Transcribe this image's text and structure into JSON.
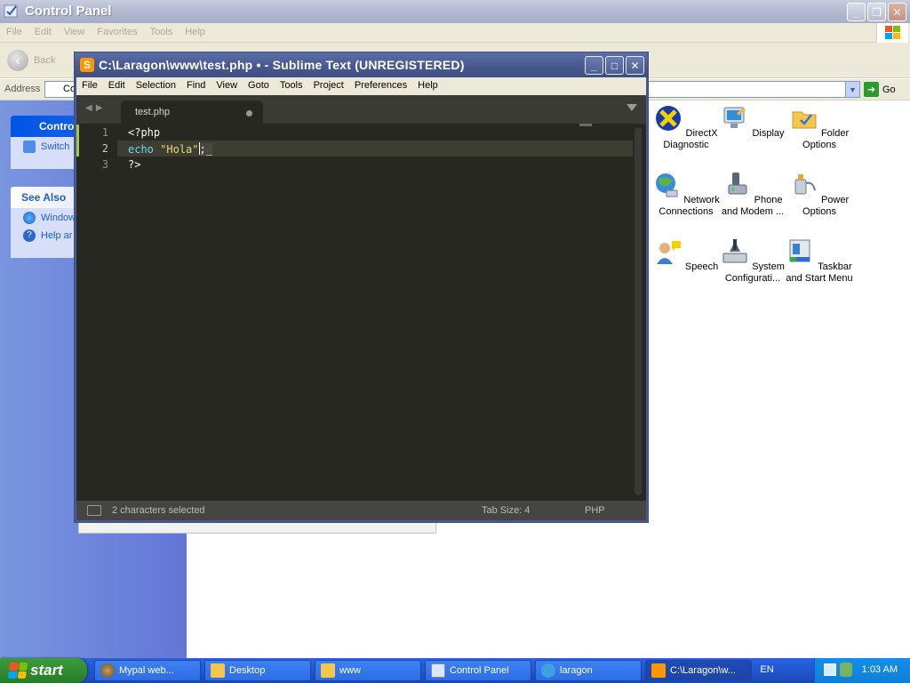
{
  "control_panel": {
    "title": "Control Panel",
    "menu": [
      "File",
      "Edit",
      "View",
      "Favorites",
      "Tools",
      "Help"
    ],
    "back_label": "Back",
    "address_label": "Address",
    "address_value": "Co",
    "go_label": "Go",
    "left_panel": {
      "header": "Contro",
      "switch_label": "Switch",
      "see_also": "See Also",
      "items": [
        "Window",
        "Help ar"
      ]
    },
    "icons": [
      {
        "label": "DirectX Diagnostic",
        "icon": "directx-icon"
      },
      {
        "label": "Display",
        "icon": "display-icon"
      },
      {
        "label": "Folder Options",
        "icon": "folder-options-icon"
      },
      {
        "label": "Network Connections",
        "icon": "network-icon"
      },
      {
        "label": "Phone and Modem ...",
        "icon": "phone-modem-icon"
      },
      {
        "label": "Power Options",
        "icon": "power-icon"
      },
      {
        "label": "Speech",
        "icon": "speech-icon"
      },
      {
        "label": "System Configurati...",
        "icon": "system-icon"
      },
      {
        "label": "Taskbar and Start Menu",
        "icon": "taskbar-icon"
      }
    ]
  },
  "sublime": {
    "title": "C:\\Laragon\\www\\test.php • - Sublime Text (UNREGISTERED)",
    "menu": [
      "File",
      "Edit",
      "Selection",
      "Find",
      "View",
      "Goto",
      "Tools",
      "Project",
      "Preferences",
      "Help"
    ],
    "tab": "test.php",
    "lines": [
      {
        "num": "1",
        "text": "<?php"
      },
      {
        "num": "2",
        "kw": "echo",
        "str": "\"Hola\"",
        "sel": ";",
        "rest": "_"
      },
      {
        "num": "3",
        "text": "?>"
      }
    ],
    "status": {
      "message": "2 characters selected",
      "tab_size": "Tab Size: 4",
      "syntax": "PHP"
    }
  },
  "taskbar": {
    "start": "start",
    "buttons": [
      {
        "label": "Mypal web..."
      },
      {
        "label": "Desktop"
      },
      {
        "label": "www"
      },
      {
        "label": "Control Panel"
      },
      {
        "label": "laragon"
      },
      {
        "label": "C:\\Laragon\\w..."
      }
    ],
    "lang": "EN",
    "clock": "1:03 AM"
  },
  "colors": {
    "sublime_bg": "#272822",
    "keyword": "#66d9ef",
    "string": "#e6db74",
    "xp_blue": "#245edb",
    "start_green": "#2f8a2f"
  }
}
